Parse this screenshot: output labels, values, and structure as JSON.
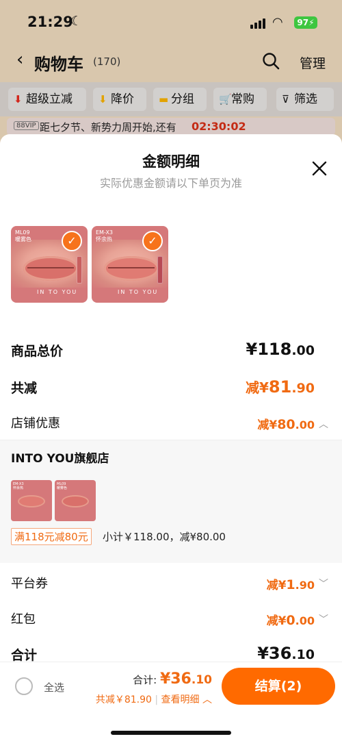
{
  "status": {
    "time": "21:29",
    "battery": "97"
  },
  "nav": {
    "title": "购物车",
    "count": "(170)",
    "manage": "管理"
  },
  "filters": [
    {
      "label": "超级立减",
      "icon": "down-arrow-icon"
    },
    {
      "label": "降价",
      "icon": "price-down-icon"
    },
    {
      "label": "分组",
      "icon": "folder-icon"
    },
    {
      "label": "常购",
      "icon": "cart-icon"
    },
    {
      "label": "筛选",
      "icon": "filter-icon"
    }
  ],
  "promo": {
    "badge": "88VIP",
    "text": "距七夕节、新势力周开始,还有",
    "timer": "02:30:02"
  },
  "sheet": {
    "title": "金额明细",
    "subtitle": "实际优惠金额请以下单页为准",
    "products": [
      {
        "code": "ML09",
        "name": "暖雾色"
      },
      {
        "code": "EM-X3",
        "name": "怀余热"
      }
    ],
    "brand_mark": "IN TO YOU",
    "rows": {
      "goods_total": {
        "label": "商品总价",
        "prefix": "¥",
        "int": "118",
        "dec": ".00"
      },
      "total_discount": {
        "label": "共减",
        "prefix": "减¥",
        "int": "81",
        "dec": ".90"
      },
      "shop_discount": {
        "label": "店铺优惠",
        "prefix": "减¥",
        "int": "80",
        "dec": ".00"
      },
      "platform_coupon": {
        "label": "平台券",
        "prefix": "减¥",
        "int": "1",
        "dec": ".90"
      },
      "red_packet": {
        "label": "红包",
        "prefix": "减¥",
        "int": "0",
        "dec": ".00"
      },
      "sum": {
        "label": "合计",
        "prefix": "¥",
        "int": "36",
        "dec": ".10"
      }
    },
    "shop": {
      "name": "INTO YOU旗舰店",
      "minis": [
        {
          "code": "EM-X3",
          "name": "怀余热"
        },
        {
          "code": "ML09",
          "name": "暖雾色"
        }
      ],
      "coupon": "满118元减80元",
      "subtotal": "小计￥118.00，减¥80.00"
    }
  },
  "bottom": {
    "select_all": "全选",
    "total_label": "合计:",
    "total_prefix": "¥",
    "total_int": "36",
    "total_dec": ".10",
    "discount_text": "共减￥81.90",
    "details_link": "查看明细",
    "checkout": "结算(2)"
  },
  "colors": {
    "accent": "#f06a12",
    "checkout": "#ff6a00"
  }
}
